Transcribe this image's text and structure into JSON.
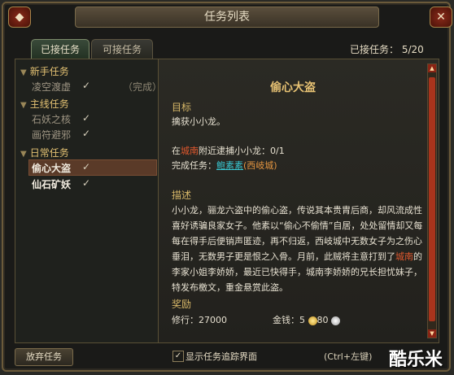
{
  "window": {
    "title": "任务列表",
    "close_glyph": "✕"
  },
  "tabs": [
    {
      "label": "已接任务",
      "active": true
    },
    {
      "label": "可接任务",
      "active": false
    }
  ],
  "accepted_count": {
    "label": "已接任务：",
    "value": "5/20"
  },
  "categories": [
    {
      "label": "新手任务",
      "items": [
        {
          "label": "凌空渡虚",
          "checked": true,
          "status": "（完成）"
        }
      ]
    },
    {
      "label": "主线任务",
      "items": [
        {
          "label": "石妖之核",
          "checked": true
        },
        {
          "label": "画符避邪",
          "checked": true
        }
      ]
    },
    {
      "label": "日常任务",
      "items": [
        {
          "label": "偷心大盗",
          "checked": true,
          "selected": true
        },
        {
          "label": "仙石矿妖",
          "checked": true
        }
      ]
    }
  ],
  "quest": {
    "title": "偷心大盗",
    "goal_heading": "目标",
    "goal_text": "擒获小小龙。",
    "location_prefix": "在",
    "location_city": "城南",
    "location_suffix": "附近逮捕小小龙：0/1",
    "turnin_label": "完成任务：",
    "turnin_npc": "鲍素素",
    "turnin_place": "(西岐城)",
    "desc_heading": "描述",
    "desc_1": "小小龙，骊龙六盗中的偷心盗，传说其本贵胄后商，却风流成性喜好诱骗良家女子。他素以“偷心不偷情”自居，处处留情却又每每在得手后便销声匿迹，再不归返，西岐城中无数女子为之伤心垂泪，无数男子更是恨之入骨。月前，此贼将主意打到了",
    "desc_city": "城南",
    "desc_2": "的李家小姐李娇娇，最近已快得手，城南李娇娇的兄长担忧妹子，特发布檄文，重金悬赏此盗。",
    "reward_heading": "奖励",
    "reward_exp_label": "修行：",
    "reward_exp": "27000",
    "reward_money_label": "金钱：",
    "reward_gold": "5",
    "reward_silver": "80"
  },
  "bottom": {
    "abandon": "放弃任务",
    "track_label": "显示任务追踪界面",
    "track_checked": true,
    "hotkey": "(Ctrl+左键)"
  },
  "watermark": "酷乐米",
  "colors": {
    "accent_gold": "#e8c374",
    "npc_link": "#38c6d0",
    "city_red": "#e0582e"
  }
}
